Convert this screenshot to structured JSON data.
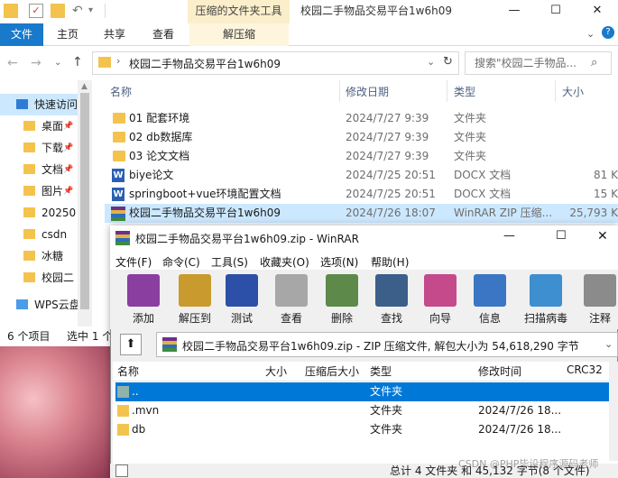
{
  "explorer": {
    "context_tab": "压缩的文件夹工具",
    "title_path": "校园二手物品交易平台1w6h09",
    "ribbon_tabs": {
      "file": "文件",
      "home": "主页",
      "share": "共享",
      "view": "查看",
      "extract": "解压缩"
    },
    "address": "校园二手物品交易平台1w6h09",
    "search_placeholder": "搜索\"校园二手物品...",
    "columns": {
      "name": "名称",
      "date": "修改日期",
      "type": "类型",
      "size": "大小"
    },
    "files": [
      {
        "name": "01 配套环境",
        "date": "2024/7/27 9:39",
        "type": "文件夹",
        "size": "",
        "kind": "folder"
      },
      {
        "name": "02 db数据库",
        "date": "2024/7/27 9:39",
        "type": "文件夹",
        "size": "",
        "kind": "folder"
      },
      {
        "name": "03 论文文档",
        "date": "2024/7/27 9:39",
        "type": "文件夹",
        "size": "",
        "kind": "folder"
      },
      {
        "name": "biye论文",
        "date": "2024/7/25 20:51",
        "type": "DOCX 文档",
        "size": "81 K",
        "kind": "docx"
      },
      {
        "name": "springboot+vue环境配置文档",
        "date": "2024/7/25 20:51",
        "type": "DOCX 文档",
        "size": "15 K",
        "kind": "docx"
      },
      {
        "name": "校园二手物品交易平台1w6h09",
        "date": "2024/7/26 18:07",
        "type": "WinRAR ZIP 压缩...",
        "size": "25,793 K",
        "kind": "rar"
      }
    ],
    "nav": [
      {
        "label": "快速访问",
        "pin": false
      },
      {
        "label": "桌面",
        "pin": true
      },
      {
        "label": "下载",
        "pin": true
      },
      {
        "label": "文档",
        "pin": true
      },
      {
        "label": "图片",
        "pin": true
      },
      {
        "label": "20250",
        "pin": false
      },
      {
        "label": "csdn",
        "pin": false
      },
      {
        "label": "冰糖",
        "pin": false
      },
      {
        "label": "校园二",
        "pin": false
      },
      {
        "label": "WPS云盘",
        "pin": false
      }
    ],
    "status_items": "6 个项目",
    "status_selected": "选中 1 个"
  },
  "winrar": {
    "title": "校园二手物品交易平台1w6h09.zip - WinRAR",
    "menu": [
      "文件(F)",
      "命令(C)",
      "工具(S)",
      "收藏夹(O)",
      "选项(N)",
      "帮助(H)"
    ],
    "tools": [
      {
        "label": "添加",
        "color": "#8a3fa0"
      },
      {
        "label": "解压到",
        "color": "#c99a2e"
      },
      {
        "label": "测试",
        "color": "#2c4fa8"
      },
      {
        "label": "查看",
        "color": "#a7a7a7"
      },
      {
        "label": "删除",
        "color": "#5d8a4a"
      },
      {
        "label": "查找",
        "color": "#3c5f8a"
      },
      {
        "label": "向导",
        "color": "#c44a8c"
      },
      {
        "label": "信息",
        "color": "#3a76c4"
      },
      {
        "label": "扫描病毒",
        "color": "#3d8fcf"
      },
      {
        "label": "注释",
        "color": "#8b8b8b"
      }
    ],
    "path": "校园二手物品交易平台1w6h09.zip - ZIP 压缩文件, 解包大小为 54,618,290 字节",
    "columns": {
      "name": "名称",
      "size": "大小",
      "packed": "压缩后大小",
      "type": "类型",
      "modified": "修改时间",
      "crc": "CRC32"
    },
    "rows": [
      {
        "name": "..",
        "type": "文件夹",
        "modified": ""
      },
      {
        "name": ".mvn",
        "type": "文件夹",
        "modified": "2024/7/26 18..."
      },
      {
        "name": "db",
        "type": "文件夹",
        "modified": "2024/7/26 18..."
      }
    ],
    "status": "总计 4 文件夹 和 45,132 字节(8 个文件)"
  },
  "watermark": "CSDN @PHP毕设程序源码老师"
}
